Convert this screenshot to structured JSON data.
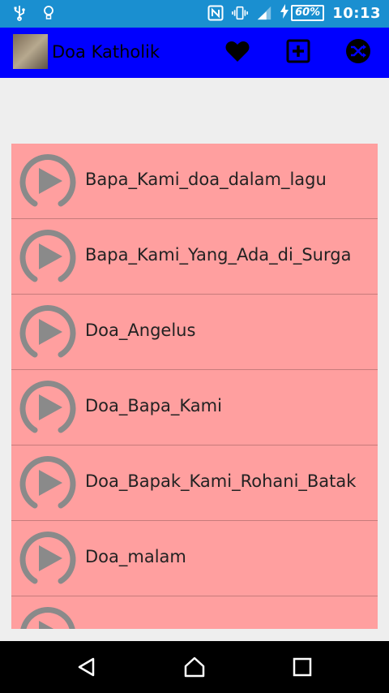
{
  "status_bar": {
    "battery_percent": "60%",
    "time": "10:13"
  },
  "app_bar": {
    "title": "Doa Katholik"
  },
  "colors": {
    "status_bar": "#1a8fd0",
    "app_bar": "#0000ff",
    "list_background": "#ff9f9f",
    "play_icon": "#8a8a8a"
  },
  "songs": [
    {
      "title": "Bapa_Kami_doa_dalam_lagu"
    },
    {
      "title": "Bapa_Kami_Yang_Ada_di_Surga"
    },
    {
      "title": "Doa_Angelus"
    },
    {
      "title": "Doa_Bapa_Kami"
    },
    {
      "title": "Doa_Bapak_Kami_Rohani_Batak"
    },
    {
      "title": "Doa_malam"
    },
    {
      "title": ""
    }
  ]
}
